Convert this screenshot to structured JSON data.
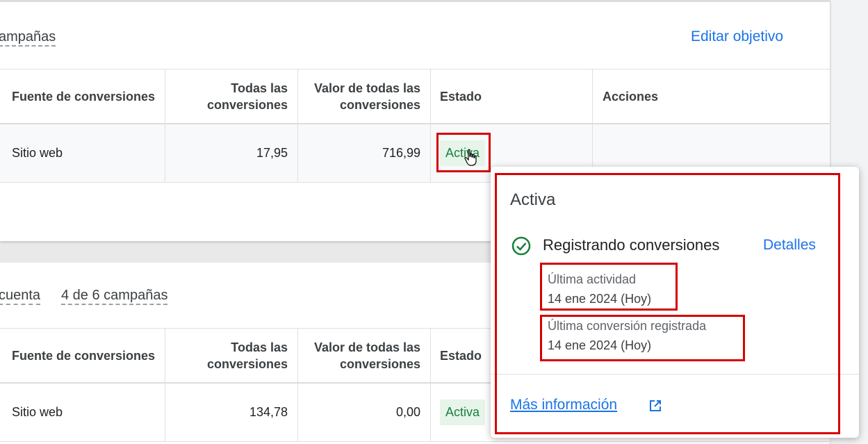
{
  "top_card": {
    "filter_label": "ampañas",
    "edit_goal": "Editar objetivo",
    "headers": {
      "source": "Fuente de conversiones",
      "all_conversions": "Todas las conversiones",
      "value_all": "Valor de todas las conversiones",
      "status": "Estado",
      "actions": "Acciones"
    },
    "row": {
      "source": "Sitio web",
      "all_conversions": "17,95",
      "value_all": "716,99",
      "status": "Activa"
    }
  },
  "bottom_card": {
    "filter_account": "cuenta",
    "filter_campaigns": "4 de 6 campañas",
    "headers": {
      "source": "Fuente de conversiones",
      "all_conversions": "Todas las conversiones",
      "value_all": "Valor de todas las conversiones",
      "status": "Estado"
    },
    "row": {
      "source": "Sitio web",
      "all_conversions": "134,78",
      "value_all": "0,00",
      "status": "Activa"
    }
  },
  "popover": {
    "title": "Activa",
    "status_text": "Registrando conversiones",
    "details_link": "Detalles",
    "last_activity_label": "Última actividad",
    "last_activity_value": "14 ene 2024 (Hoy)",
    "last_conversion_label": "Última conversión registrada",
    "last_conversion_value": "14 ene 2024 (Hoy)",
    "more_info": "Más información"
  },
  "colors": {
    "accent": "#1a73e8",
    "success": "#188038",
    "highlight": "#d50000"
  }
}
